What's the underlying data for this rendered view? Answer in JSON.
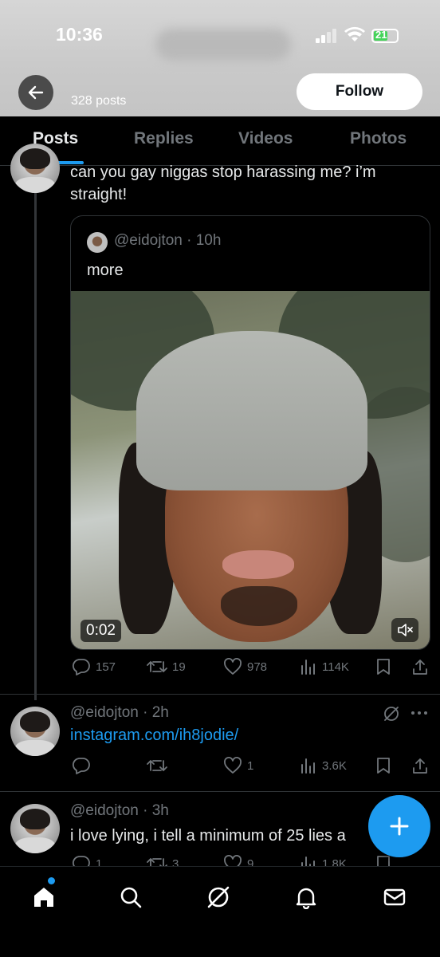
{
  "status_bar": {
    "time": "10:36",
    "battery": "21"
  },
  "header": {
    "posts_count": "328 posts",
    "follow_label": "Follow"
  },
  "tabs": [
    {
      "label": "Posts",
      "active": true
    },
    {
      "label": "Replies"
    },
    {
      "label": "Videos"
    },
    {
      "label": "Photos"
    }
  ],
  "post1": {
    "text_line1": "can you gay niggas stop harassing me? i’m",
    "text_line2": "straight!",
    "quote": {
      "handle": "@eidojton",
      "time": "10h",
      "text": "more",
      "video_time": "0:02"
    },
    "actions": {
      "replies": "157",
      "reposts": "19",
      "likes": "978",
      "views": "114K"
    }
  },
  "post2": {
    "handle": "@eidojton",
    "time": "2h",
    "link": "instagram.com/ih8jodie/",
    "actions": {
      "replies": "",
      "reposts": "",
      "likes": "1",
      "views": "3.6K"
    }
  },
  "post3": {
    "handle": "@eidojton",
    "time": "3h",
    "text": "i love lying, i tell a minimum of 25 lies a",
    "actions": {
      "replies": "1",
      "reposts": "3",
      "likes": "9",
      "views": "1.8K"
    }
  },
  "colors": {
    "accent": "#1d9bf0",
    "muted": "#71767b",
    "text": "#e7e9ea",
    "background": "#000000"
  },
  "icons": [
    "back-arrow-icon",
    "reply-icon",
    "repost-icon",
    "like-icon",
    "views-icon",
    "bookmark-icon",
    "share-icon",
    "grok-icon",
    "more-icon",
    "mute-icon",
    "plus-icon",
    "home-icon",
    "search-icon",
    "notifications-icon",
    "messages-icon"
  ]
}
